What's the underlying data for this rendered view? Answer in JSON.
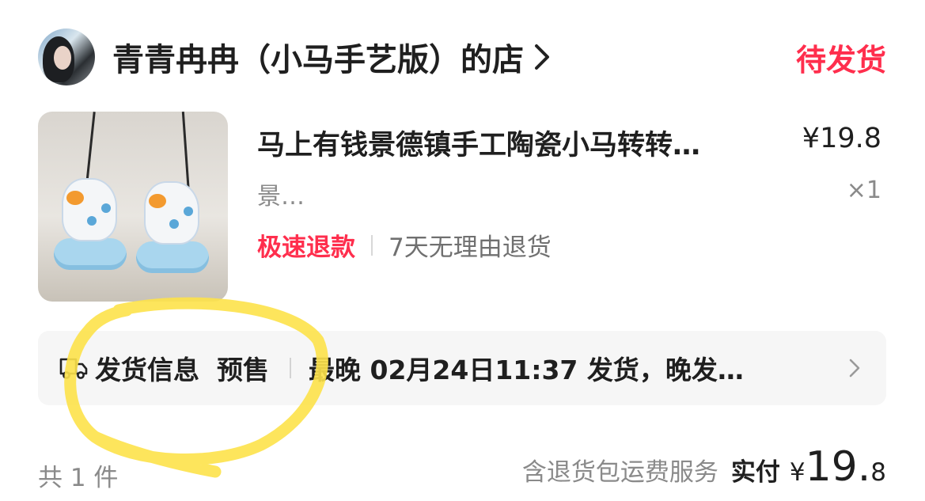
{
  "shop": {
    "name": "青青冉冉（小马手艺版）的店",
    "status": "待发货"
  },
  "product": {
    "title": "马上有钱景德镇手工陶瓷小马转转…",
    "price": "¥19.8",
    "spec": "景…",
    "quantity": "×1",
    "tag_fast_refund": "极速退款",
    "tag_return_policy": "7天无理由退货"
  },
  "shipping": {
    "label": "发货信息",
    "presale": "预售",
    "info": "最晚 02月24日11:37 发货，晚发…"
  },
  "footer": {
    "count": "共 1 件",
    "service": "含退货包运费服务",
    "paid_label": "实付",
    "currency": "¥",
    "amount_int": "19.",
    "amount_dec": "8"
  },
  "colors": {
    "accent_red": "#ff2e4d",
    "highlight_yellow": "#fde24a"
  },
  "icons": {
    "shop_chevron": "chevron-right-icon",
    "truck": "truck-icon",
    "shipping_chevron": "chevron-right-icon"
  }
}
